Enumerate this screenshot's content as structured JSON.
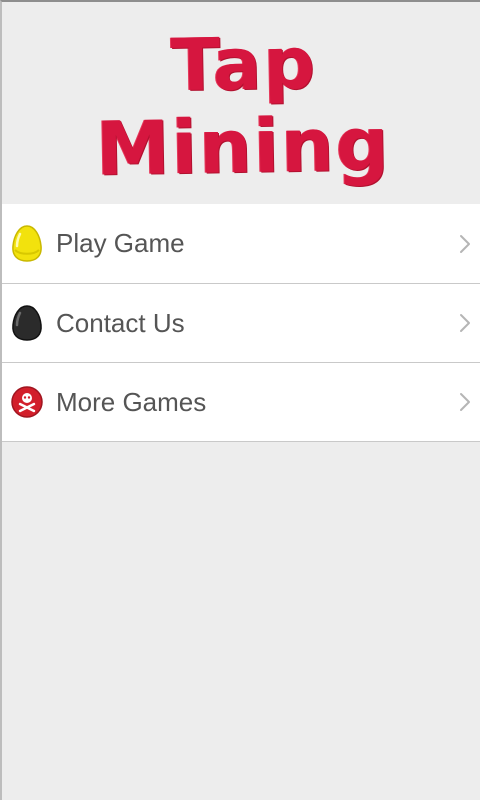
{
  "app": {
    "logo_line1": "Tap",
    "logo_line2": "Mining"
  },
  "menu": {
    "items": [
      {
        "label": "Play Game",
        "icon": "yellow-gem-icon",
        "color": "#f2e20d"
      },
      {
        "label": "Contact Us",
        "icon": "black-gem-icon",
        "color": "#2b2b2b"
      },
      {
        "label": "More Games",
        "icon": "red-skull-badge-icon",
        "color": "#d21f2b"
      }
    ]
  },
  "colors": {
    "logo": "#d6163f",
    "label": "#555555",
    "chevron": "#b5b5b5"
  }
}
